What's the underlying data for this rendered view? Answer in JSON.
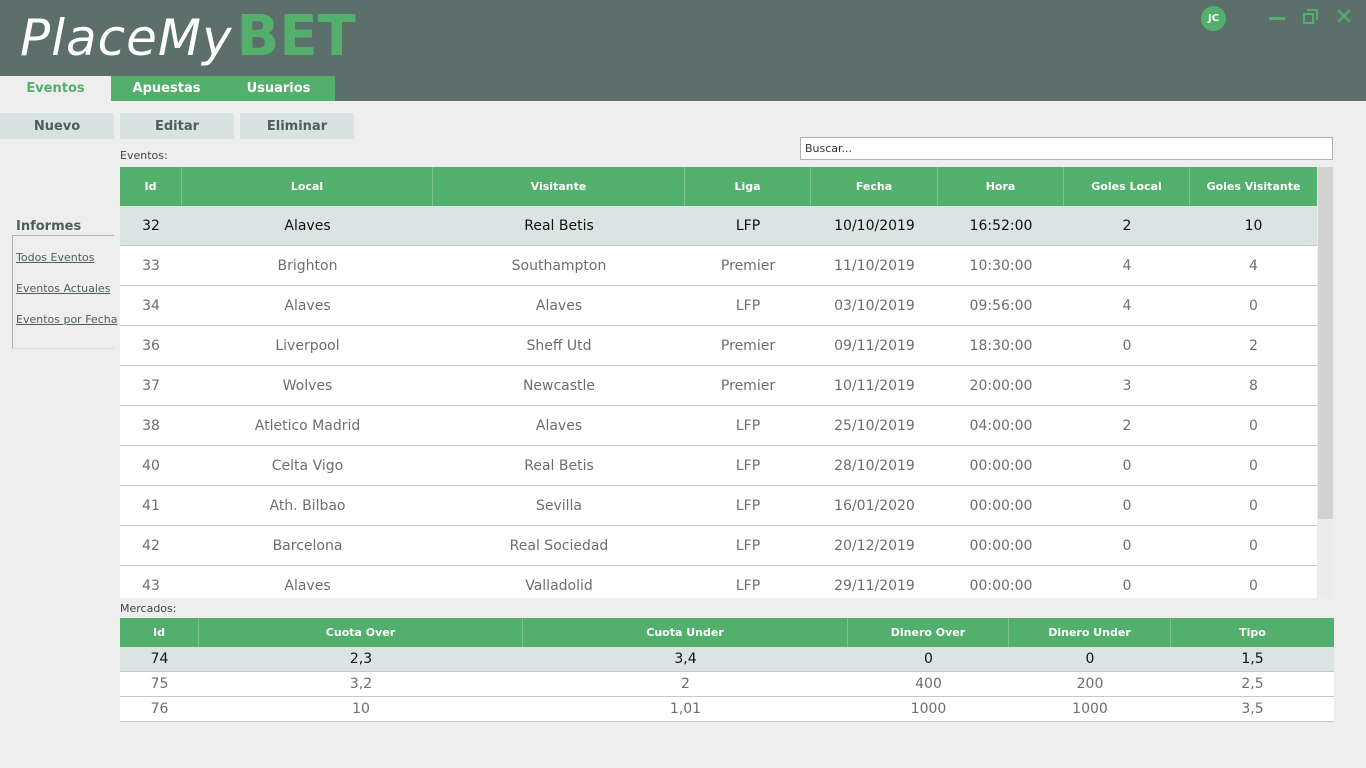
{
  "app": {
    "logo_place": "PlaceMy",
    "logo_bet": "BET",
    "user_initials": "JC"
  },
  "tabs": [
    "Eventos",
    "Apuestas",
    "Usuarios"
  ],
  "toolbar": {
    "nuevo": "Nuevo",
    "editar": "Editar",
    "eliminar": "Eliminar"
  },
  "search": {
    "placeholder": "Buscar..."
  },
  "sidebar": {
    "title": "Informes",
    "links": [
      "Todos Eventos",
      "Eventos Actuales",
      "Eventos por Fecha"
    ]
  },
  "eventos": {
    "caption": "Eventos:",
    "columns": [
      "Id",
      "Local",
      "Visitante",
      "Liga",
      "Fecha",
      "Hora",
      "Goles Local",
      "Goles Visitante"
    ],
    "rows": [
      [
        "32",
        "Alaves",
        "Real Betis",
        "LFP",
        "10/10/2019",
        "16:52:00",
        "2",
        "10"
      ],
      [
        "33",
        "Brighton",
        "Southampton",
        "Premier",
        "11/10/2019",
        "10:30:00",
        "4",
        "4"
      ],
      [
        "34",
        "Alaves",
        "Alaves",
        "LFP",
        "03/10/2019",
        "09:56:00",
        "4",
        "0"
      ],
      [
        "36",
        "Liverpool",
        "Sheff Utd",
        "Premier",
        "09/11/2019",
        "18:30:00",
        "0",
        "2"
      ],
      [
        "37",
        "Wolves",
        "Newcastle",
        "Premier",
        "10/11/2019",
        "20:00:00",
        "3",
        "8"
      ],
      [
        "38",
        "Atletico Madrid",
        "Alaves",
        "LFP",
        "25/10/2019",
        "04:00:00",
        "2",
        "0"
      ],
      [
        "40",
        "Celta Vigo",
        "Real Betis",
        "LFP",
        "28/10/2019",
        "00:00:00",
        "0",
        "0"
      ],
      [
        "41",
        "Ath. Bilbao",
        "Sevilla",
        "LFP",
        "16/01/2020",
        "00:00:00",
        "0",
        "0"
      ],
      [
        "42",
        "Barcelona",
        "Real Sociedad",
        "LFP",
        "20/12/2019",
        "00:00:00",
        "0",
        "0"
      ],
      [
        "43",
        "Alaves",
        "Valladolid",
        "LFP",
        "29/11/2019",
        "00:00:00",
        "0",
        "0"
      ]
    ],
    "selected_index": 0
  },
  "mercados": {
    "caption": "Mercados:",
    "columns": [
      "Id",
      "Cuota Over",
      "Cuota Under",
      "Dinero Over",
      "Dinero Under",
      "Tipo"
    ],
    "rows": [
      [
        "74",
        "2,3",
        "3,4",
        "0",
        "0",
        "1,5"
      ],
      [
        "75",
        "3,2",
        "2",
        "400",
        "200",
        "2,5"
      ],
      [
        "76",
        "10",
        "1,01",
        "1000",
        "1000",
        "3,5"
      ]
    ],
    "selected_index": 0
  },
  "colors": {
    "header_bg": "#5d6f6b",
    "accent_green": "#53b06c",
    "selected_row": "#d9e4e3"
  }
}
